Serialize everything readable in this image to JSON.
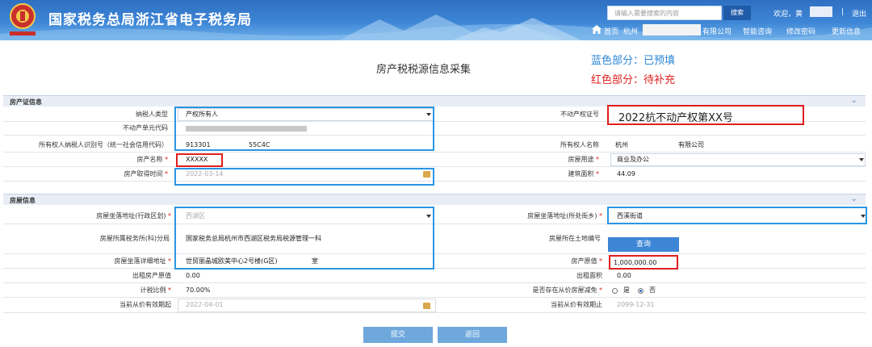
{
  "header": {
    "site_title": "国家税务总局浙江省电子税务局",
    "search_placeholder": "请输入需要搜索的内容",
    "search_button": "搜索",
    "welcome": "欢迎，黄",
    "logout": "退出",
    "nav": {
      "home": "首页",
      "company_prefix": "杭州",
      "company_suffix": "有限公司",
      "smart_consult": "智能咨询",
      "change_password": "修改密码",
      "update_info": "更新信息"
    }
  },
  "page_title": "房产税税源信息采集",
  "legend": {
    "blue": "蓝色部分：已预填",
    "red": "红色部分：待补充"
  },
  "section_property_cert": {
    "title": "房产证信息",
    "taxpayer_type_label": "纳税人类型",
    "taxpayer_type_value": "产权所有人",
    "unit_code_label": "不动产单元代码",
    "owner_id_label": "所有权人纳税人识别号（统一社会信用代码）",
    "owner_id_part1": "913301",
    "owner_id_part2": "55C4C",
    "property_name_label": "房产名称",
    "property_name_value": "XXXXX",
    "acquire_time_label": "房产取得时间",
    "acquire_time_value": "2022-03-14",
    "cert_no_label": "不动产权证号",
    "cert_no_value": "2022杭不动产权第XX号",
    "owner_name_label": "所有权人名称",
    "owner_name_part1": "杭州",
    "owner_name_part2": "有限公司",
    "usage_label": "房屋用途",
    "usage_value": "商业及办公",
    "area_label": "建筑面积",
    "area_value": "44.09"
  },
  "section_house": {
    "title": "房屋信息",
    "district_label": "房屋坐落地址(行政区划)",
    "district_value": "西湖区",
    "street_label": "房屋坐落地址(所处街乡)",
    "street_value": "西溪街道",
    "tax_office_label": "房屋所属税务所(科)分局",
    "tax_office_value": "国家税务总局杭州市西湖区税务局税源管理一科",
    "land_no_label": "房屋所在土地编号",
    "query_button": "查询",
    "detail_address_label": "房屋坐落详细地址",
    "detail_address_value": "世贸丽晶城欧美中心2号楼(G区)",
    "detail_address_suffix": "室",
    "original_value_label": "房产原值",
    "original_value_value": "1,000,000.00",
    "rent_original_label": "出租房产原值",
    "rent_original_value": "0.00",
    "rent_area_label": "出租面积",
    "rent_area_value": "0.00",
    "tax_ratio_label": "计税比例",
    "tax_ratio_value": "70.00%",
    "reduction_label": "是否存在从价房屋减免",
    "reduction_yes": "是",
    "reduction_no": "否",
    "valid_from_label": "当前从价有效期起",
    "valid_from_value": "2022-04-01",
    "valid_to_label": "当前从价有效期止",
    "valid_to_value": "2099-12-31"
  },
  "actions": {
    "submit": "提交",
    "back": "返回"
  },
  "colors": {
    "header_blue": "#3d86d6",
    "highlight_blue": "#2a96e2",
    "highlight_red": "#e01e1e",
    "button_blue": "#6fa8dc"
  }
}
